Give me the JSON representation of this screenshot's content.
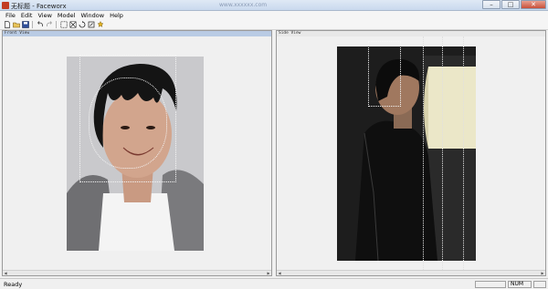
{
  "window": {
    "title": "无标题 - Faceworx",
    "center_caption": "www.xxxxxx.com",
    "minimize": "–",
    "maximize": "□",
    "close": "✕"
  },
  "menu": [
    {
      "label": "File"
    },
    {
      "label": "Edit"
    },
    {
      "label": "View"
    },
    {
      "label": "Model"
    },
    {
      "label": "Window"
    },
    {
      "label": "Help"
    }
  ],
  "toolbar": {
    "icons": [
      "new-file-icon",
      "open-folder-icon",
      "save-icon",
      "undo-icon",
      "redo-icon",
      "fit-icon",
      "move-icon",
      "rotate-icon",
      "scale-icon",
      "help-icon"
    ]
  },
  "panes": {
    "front": {
      "title": "Front View"
    },
    "side": {
      "title": "Side View"
    }
  },
  "status": {
    "text": "Ready",
    "num": "NUM"
  },
  "colors": {
    "accent": "#b9cbe4",
    "titlebar": "#c9d9ee"
  }
}
